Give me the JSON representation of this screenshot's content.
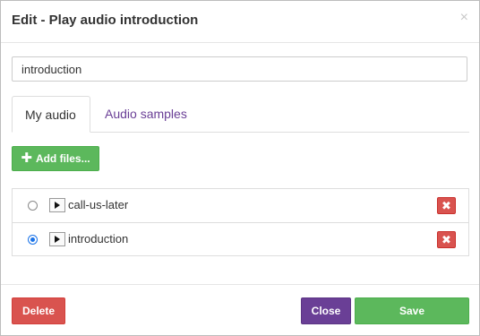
{
  "dialog": {
    "title": "Edit - Play audio introduction",
    "close_glyph": "×"
  },
  "name_field": {
    "value": "introduction"
  },
  "tabs": [
    {
      "label": "My audio",
      "active": true
    },
    {
      "label": "Audio samples",
      "active": false
    }
  ],
  "toolbar": {
    "add_files_label": "Add files...",
    "add_icon": "plus-icon"
  },
  "audio_files": [
    {
      "name": "call-us-later",
      "selected": false,
      "remove_glyph": "✖"
    },
    {
      "name": "introduction",
      "selected": true,
      "remove_glyph": "✖"
    }
  ],
  "footer": {
    "delete_label": "Delete",
    "close_label": "Close",
    "save_label": "Save"
  },
  "colors": {
    "primary_green": "#5cb85c",
    "danger_red": "#d9534f",
    "accent_purple": "#6a3f96",
    "radio_blue": "#1a73e8"
  }
}
